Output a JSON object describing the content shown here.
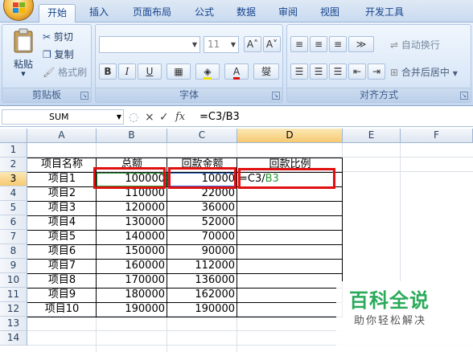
{
  "ribbon_tabs": [
    "开始",
    "插入",
    "页面布局",
    "公式",
    "数据",
    "审阅",
    "视图",
    "开发工具"
  ],
  "clipboard": {
    "paste": "粘贴",
    "cut": "剪切",
    "copy": "复制",
    "format_painter": "格式刷",
    "label": "剪贴板"
  },
  "font": {
    "font_size": "11",
    "bold": "B",
    "italic": "I",
    "underline": "U",
    "label": "字体",
    "increase_font_icon": "A˄",
    "decrease_font_icon": "A˅",
    "font_color_icon": "A",
    "phonetic_icon": "燮"
  },
  "alignment": {
    "wrap_text": "自动换行",
    "merge_center": "合并后居中",
    "label": "对齐方式"
  },
  "formula_bar": {
    "name_box": "SUM",
    "cancel_icon": "×",
    "enter_icon": "✓",
    "fx_icon": "fx",
    "formula": "=C3/B3"
  },
  "columns": [
    "A",
    "B",
    "C",
    "D",
    "E",
    "F"
  ],
  "rows": [
    "1",
    "2",
    "3",
    "4",
    "5",
    "6",
    "7",
    "8",
    "9",
    "10",
    "11",
    "12",
    "13",
    "14"
  ],
  "table": {
    "headers": [
      "项目名称",
      "总额",
      "回款金额",
      "回款比例"
    ],
    "editing_cell": {
      "part1": "=C3/",
      "part2": "B3"
    },
    "data": [
      [
        "项目1",
        "100000",
        "10000"
      ],
      [
        "项目2",
        "110000",
        "22000"
      ],
      [
        "项目3",
        "120000",
        "36000"
      ],
      [
        "项目4",
        "130000",
        "52000"
      ],
      [
        "项目5",
        "140000",
        "70000"
      ],
      [
        "项目6",
        "150000",
        "90000"
      ],
      [
        "项目7",
        "160000",
        "112000"
      ],
      [
        "项目8",
        "170000",
        "136000"
      ],
      [
        "项目9",
        "180000",
        "162000"
      ],
      [
        "项目10",
        "190000",
        "190000"
      ]
    ]
  },
  "watermark": {
    "title": "百科全说",
    "subtitle": "助你轻松解决"
  },
  "colors": {
    "highlight_red": "#e01010",
    "ref_blue": "#2f6bd1",
    "ref_green": "#2a9a36",
    "watermark_green": "#2aaa5a"
  }
}
